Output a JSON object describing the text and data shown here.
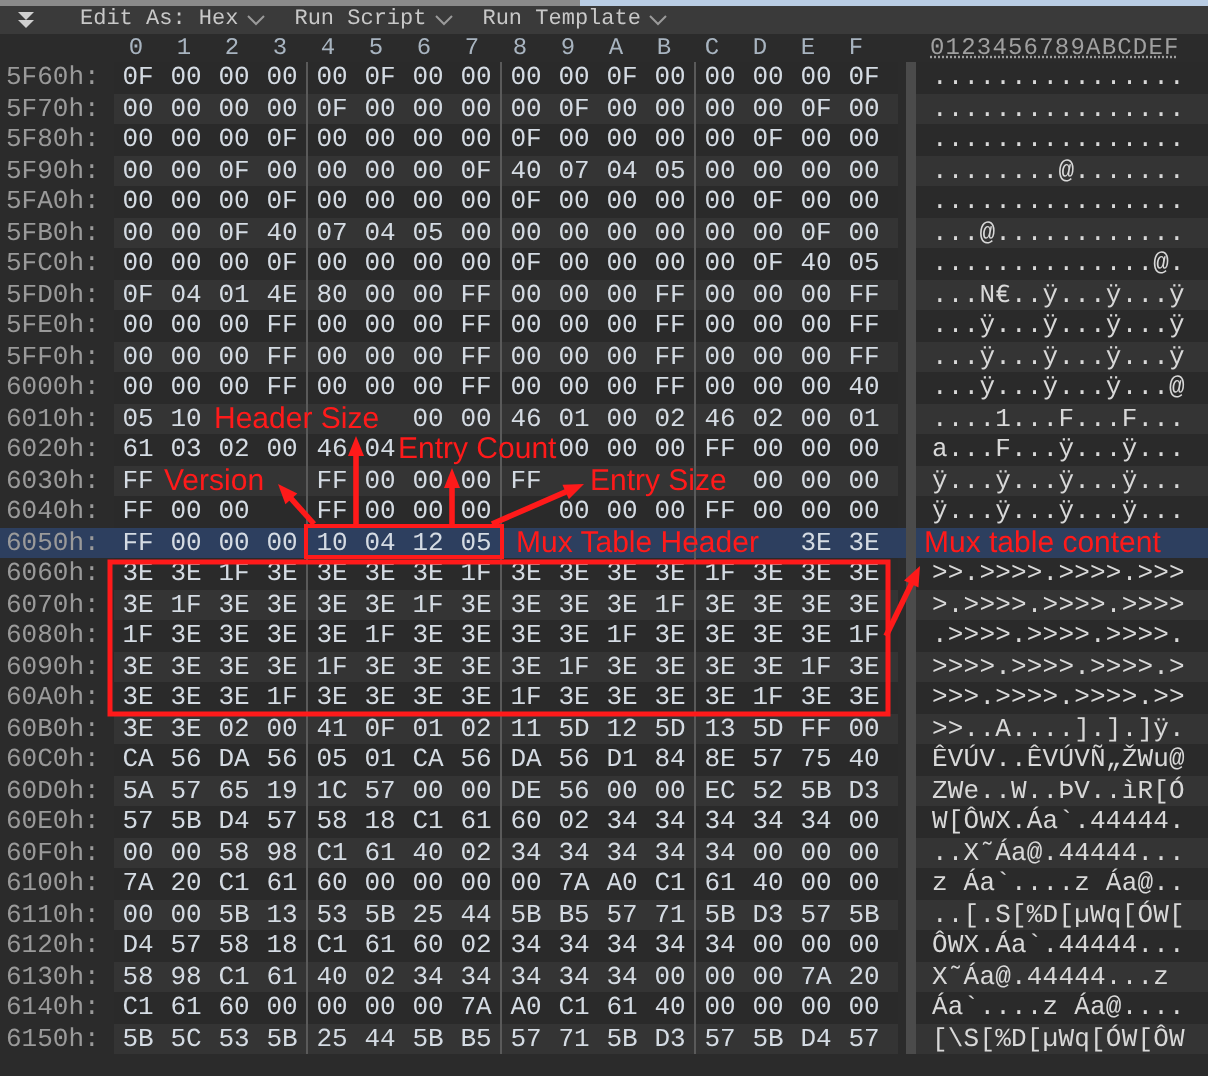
{
  "toolbar": {
    "items": [
      {
        "label": "Edit As: Hex"
      },
      {
        "label": "Run Script"
      },
      {
        "label": "Run Template"
      }
    ]
  },
  "columns": [
    "0",
    "1",
    "2",
    "3",
    "4",
    "5",
    "6",
    "7",
    "8",
    "9",
    "A",
    "B",
    "C",
    "D",
    "E",
    "F"
  ],
  "ascii_header": "0123456789ABCDEF",
  "rows": [
    {
      "address": "5F60h:",
      "bytes": [
        "0F",
        "00",
        "00",
        "00",
        "00",
        "0F",
        "00",
        "00",
        "00",
        "00",
        "0F",
        "00",
        "00",
        "00",
        "00",
        "0F"
      ],
      "ascii": "................",
      "selected": false
    },
    {
      "address": "5F70h:",
      "bytes": [
        "00",
        "00",
        "00",
        "00",
        "0F",
        "00",
        "00",
        "00",
        "00",
        "0F",
        "00",
        "00",
        "00",
        "00",
        "0F",
        "00"
      ],
      "ascii": "................",
      "selected": false
    },
    {
      "address": "5F80h:",
      "bytes": [
        "00",
        "00",
        "00",
        "0F",
        "00",
        "00",
        "00",
        "00",
        "0F",
        "00",
        "00",
        "00",
        "00",
        "0F",
        "00",
        "00"
      ],
      "ascii": "................",
      "selected": false
    },
    {
      "address": "5F90h:",
      "bytes": [
        "00",
        "00",
        "0F",
        "00",
        "00",
        "00",
        "00",
        "0F",
        "40",
        "07",
        "04",
        "05",
        "00",
        "00",
        "00",
        "00"
      ],
      "ascii": "........@.......",
      "selected": false
    },
    {
      "address": "5FA0h:",
      "bytes": [
        "00",
        "00",
        "00",
        "0F",
        "00",
        "00",
        "00",
        "00",
        "0F",
        "00",
        "00",
        "00",
        "00",
        "0F",
        "00",
        "00"
      ],
      "ascii": "................",
      "selected": false
    },
    {
      "address": "5FB0h:",
      "bytes": [
        "00",
        "00",
        "0F",
        "40",
        "07",
        "04",
        "05",
        "00",
        "00",
        "00",
        "00",
        "00",
        "00",
        "00",
        "0F",
        "00"
      ],
      "ascii": "...@............",
      "selected": false
    },
    {
      "address": "5FC0h:",
      "bytes": [
        "00",
        "00",
        "00",
        "0F",
        "00",
        "00",
        "00",
        "00",
        "0F",
        "00",
        "00",
        "00",
        "00",
        "0F",
        "40",
        "05"
      ],
      "ascii": "..............@.",
      "selected": false
    },
    {
      "address": "5FD0h:",
      "bytes": [
        "0F",
        "04",
        "01",
        "4E",
        "80",
        "00",
        "00",
        "FF",
        "00",
        "00",
        "00",
        "FF",
        "00",
        "00",
        "00",
        "FF"
      ],
      "ascii": "...N€..ÿ...ÿ...ÿ",
      "selected": false
    },
    {
      "address": "5FE0h:",
      "bytes": [
        "00",
        "00",
        "00",
        "FF",
        "00",
        "00",
        "00",
        "FF",
        "00",
        "00",
        "00",
        "FF",
        "00",
        "00",
        "00",
        "FF"
      ],
      "ascii": "...ÿ...ÿ...ÿ...ÿ",
      "selected": false
    },
    {
      "address": "5FF0h:",
      "bytes": [
        "00",
        "00",
        "00",
        "FF",
        "00",
        "00",
        "00",
        "FF",
        "00",
        "00",
        "00",
        "FF",
        "00",
        "00",
        "00",
        "FF"
      ],
      "ascii": "...ÿ...ÿ...ÿ...ÿ",
      "selected": false
    },
    {
      "address": "6000h:",
      "bytes": [
        "00",
        "00",
        "00",
        "FF",
        "00",
        "00",
        "00",
        "FF",
        "00",
        "00",
        "00",
        "FF",
        "00",
        "00",
        "00",
        "40"
      ],
      "ascii": "...ÿ...ÿ...ÿ...@",
      "selected": false
    },
    {
      "address": "6010h:",
      "bytes": [
        "05",
        "10",
        {
          "kind": "covered"
        },
        {
          "kind": "covered"
        },
        {
          "kind": "covered"
        },
        {
          "kind": "covered"
        },
        "00",
        "00",
        "46",
        "01",
        "00",
        "02",
        "46",
        "02",
        "00",
        "01"
      ],
      "ascii": "....1...F...F...",
      "selected": false
    },
    {
      "address": "6020h:",
      "bytes": [
        "61",
        "03",
        "02",
        "00",
        "46",
        "04",
        {
          "kind": "covered"
        },
        {
          "kind": "covered"
        },
        {
          "kind": "covered"
        },
        "00",
        "00",
        "00",
        "FF",
        "00",
        "00",
        "00"
      ],
      "ascii": "a...F...ÿ...ÿ...",
      "selected": false
    },
    {
      "address": "6030h:",
      "bytes": [
        "FF",
        {
          "kind": "covered"
        },
        {
          "kind": "covered"
        },
        {
          "kind": "covered"
        },
        "FF",
        "00",
        "00",
        "00",
        "FF",
        {
          "kind": "covered"
        },
        {
          "kind": "covered"
        },
        {
          "kind": "covered"
        },
        {
          "kind": "covered"
        },
        "00",
        "00",
        "00"
      ],
      "ascii": "ÿ...ÿ...ÿ...ÿ...",
      "selected": false
    },
    {
      "address": "6040h:",
      "bytes": [
        "FF",
        "00",
        "00",
        {
          "kind": "covered"
        },
        "FF",
        "00",
        "00",
        "00",
        {
          "kind": "covered"
        },
        "00",
        "00",
        "00",
        "FF",
        "00",
        "00",
        "00"
      ],
      "ascii": "ÿ...ÿ...ÿ...ÿ...",
      "selected": false
    },
    {
      "address": "6050h:",
      "bytes": [
        "FF",
        "00",
        "00",
        "00",
        "10",
        "04",
        "12",
        "05",
        {
          "kind": "covered"
        },
        {
          "kind": "covered"
        },
        {
          "kind": "covered"
        },
        {
          "kind": "covered"
        },
        {
          "kind": "covered"
        },
        {
          "kind": "covered"
        },
        "3E",
        "3E"
      ],
      "selected": true
    },
    {
      "address": "6060h:",
      "bytes": [
        "3E",
        "3E",
        "1F",
        "3E",
        "3E",
        "3E",
        "3E",
        "1F",
        "3E",
        "3E",
        "3E",
        "3E",
        "1F",
        "3E",
        "3E",
        "3E"
      ],
      "ascii": ">>.>>>>.>>>>.>>>",
      "selected": false
    },
    {
      "address": "6070h:",
      "bytes": [
        "3E",
        "1F",
        "3E",
        "3E",
        "3E",
        "3E",
        "1F",
        "3E",
        "3E",
        "3E",
        "3E",
        "1F",
        "3E",
        "3E",
        "3E",
        "3E"
      ],
      "ascii": ">.>>>>.>>>>.>>>>",
      "selected": false
    },
    {
      "address": "6080h:",
      "bytes": [
        "1F",
        "3E",
        "3E",
        "3E",
        "3E",
        "1F",
        "3E",
        "3E",
        "3E",
        "3E",
        "1F",
        "3E",
        "3E",
        "3E",
        "3E",
        "1F"
      ],
      "ascii": ".>>>>.>>>>.>>>>.",
      "selected": false
    },
    {
      "address": "6090h:",
      "bytes": [
        "3E",
        "3E",
        "3E",
        "3E",
        "1F",
        "3E",
        "3E",
        "3E",
        "3E",
        "1F",
        "3E",
        "3E",
        "3E",
        "3E",
        "1F",
        "3E"
      ],
      "ascii": ">>>>.>>>>.>>>>.>",
      "selected": false
    },
    {
      "address": "60A0h:",
      "bytes": [
        "3E",
        "3E",
        "3E",
        "1F",
        "3E",
        "3E",
        "3E",
        "3E",
        "1F",
        "3E",
        "3E",
        "3E",
        "3E",
        "1F",
        "3E",
        "3E"
      ],
      "ascii": ">>>.>>>>.>>>>.>>",
      "selected": false
    },
    {
      "address": "60B0h:",
      "bytes": [
        "3E",
        "3E",
        "02",
        "00",
        "41",
        "0F",
        "01",
        "02",
        "11",
        "5D",
        "12",
        "5D",
        "13",
        "5D",
        "FF",
        "00"
      ],
      "ascii": ">>..A....].].]ÿ.",
      "selected": false
    },
    {
      "address": "60C0h:",
      "bytes": [
        "CA",
        "56",
        "DA",
        "56",
        "05",
        "01",
        "CA",
        "56",
        "DA",
        "56",
        "D1",
        "84",
        "8E",
        "57",
        "75",
        "40"
      ],
      "ascii": "ÊVÚV..ÊVÚVÑ„ŽWu@",
      "selected": false
    },
    {
      "address": "60D0h:",
      "bytes": [
        "5A",
        "57",
        "65",
        "19",
        "1C",
        "57",
        "00",
        "00",
        "DE",
        "56",
        "00",
        "00",
        "EC",
        "52",
        "5B",
        "D3"
      ],
      "ascii": "ZWe..W..ÞV..ìR[Ó",
      "selected": false
    },
    {
      "address": "60E0h:",
      "bytes": [
        "57",
        "5B",
        "D4",
        "57",
        "58",
        "18",
        "C1",
        "61",
        "60",
        "02",
        "34",
        "34",
        "34",
        "34",
        "34",
        "00"
      ],
      "ascii": "W[ÔWX.Áa`.44444.",
      "selected": false
    },
    {
      "address": "60F0h:",
      "bytes": [
        "00",
        "00",
        "58",
        "98",
        "C1",
        "61",
        "40",
        "02",
        "34",
        "34",
        "34",
        "34",
        "34",
        "00",
        "00",
        "00"
      ],
      "ascii": "..X˜Áa@.44444...",
      "selected": false
    },
    {
      "address": "6100h:",
      "bytes": [
        "7A",
        "20",
        "C1",
        "61",
        "60",
        "00",
        "00",
        "00",
        "00",
        "7A",
        "A0",
        "C1",
        "61",
        "40",
        "00",
        "00"
      ],
      "ascii": "z Áa`....z Áa@..",
      "selected": false
    },
    {
      "address": "6110h:",
      "bytes": [
        "00",
        "00",
        "5B",
        "13",
        "53",
        "5B",
        "25",
        "44",
        "5B",
        "B5",
        "57",
        "71",
        "5B",
        "D3",
        "57",
        "5B"
      ],
      "ascii": "..[.S[%D[µWq[ÓW[",
      "selected": false
    },
    {
      "address": "6120h:",
      "bytes": [
        "D4",
        "57",
        "58",
        "18",
        "C1",
        "61",
        "60",
        "02",
        "34",
        "34",
        "34",
        "34",
        "34",
        "00",
        "00",
        "00"
      ],
      "ascii": "ÔWX.Áa`.44444...",
      "selected": false
    },
    {
      "address": "6130h:",
      "bytes": [
        "58",
        "98",
        "C1",
        "61",
        "40",
        "02",
        "34",
        "34",
        "34",
        "34",
        "34",
        "00",
        "00",
        "00",
        "7A",
        "20"
      ],
      "ascii": "X˜Áa@.44444...z ",
      "selected": false
    },
    {
      "address": "6140h:",
      "bytes": [
        "C1",
        "61",
        "60",
        "00",
        "00",
        "00",
        "00",
        "7A",
        "A0",
        "C1",
        "61",
        "40",
        "00",
        "00",
        "00",
        "00"
      ],
      "ascii": "Áa`....z Áa@....",
      "selected": false
    },
    {
      "address": "6150h:",
      "bytes": [
        "5B",
        "5C",
        "53",
        "5B",
        "25",
        "44",
        "5B",
        "B5",
        "57",
        "71",
        "5B",
        "D3",
        "57",
        "5B",
        "D4",
        "57"
      ],
      "ascii": "[\\S[%D[µWq[ÓW[ÔW",
      "selected": false
    }
  ],
  "annotations": [
    {
      "label": "Header Size"
    },
    {
      "label": "Entry Count"
    },
    {
      "label": "Version"
    },
    {
      "label": "Entry Size"
    },
    {
      "label": "Mux Table Header"
    },
    {
      "label": "Mux table content"
    }
  ]
}
